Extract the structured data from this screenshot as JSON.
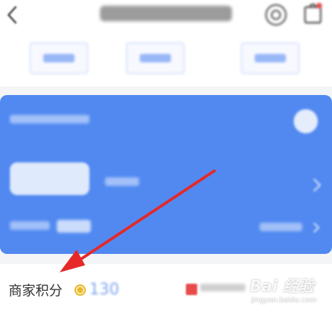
{
  "points": {
    "label": "商家积分",
    "value": "130"
  },
  "watermark": {
    "brand": "Bai 经验",
    "url": "jingyan.baidu.com"
  },
  "icons": {
    "back": "chevron-left-icon",
    "service": "headset-icon",
    "bag": "shopping-bag-icon",
    "coin": "coin-icon",
    "help": "question-circle-icon",
    "arrow": "chevron-right-icon"
  },
  "colors": {
    "card": "#5189f1",
    "accent": "#4a82f0",
    "annotation": "#e62828",
    "coin": "#e8b830"
  }
}
